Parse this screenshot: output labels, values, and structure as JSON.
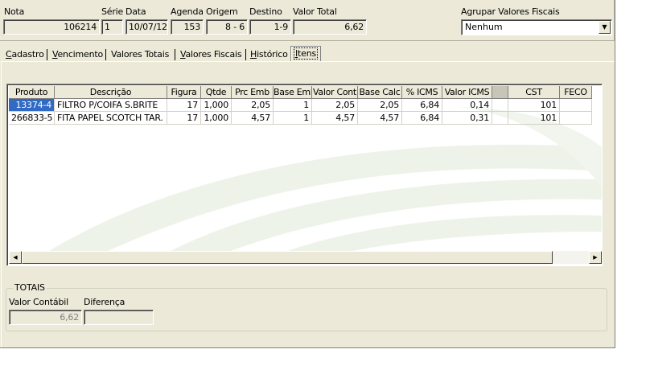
{
  "header": {
    "nota": {
      "label": "Nota",
      "value": "106214"
    },
    "serie": {
      "label": "Série",
      "value": "1"
    },
    "data": {
      "label": "Data",
      "value": "10/07/12"
    },
    "agenda": {
      "label": "Agenda",
      "value": "153"
    },
    "origem": {
      "label": "Origem",
      "value": "8 - 6"
    },
    "destino": {
      "label": "Destino",
      "value": "1-9"
    },
    "valor_total": {
      "label": "Valor Total",
      "value": "6,62"
    },
    "agrupar": {
      "label": "Agrupar Valores Fiscais",
      "value": "Nenhum"
    }
  },
  "tabs": [
    {
      "label": "Cadastro",
      "ul": "C",
      "rest": "adastro"
    },
    {
      "label": "Vencimento",
      "ul": "V",
      "rest": "encimento"
    },
    {
      "label": "Valores Totais",
      "ul": "",
      "rest": "Valores Totais"
    },
    {
      "label": "Valores Fiscais",
      "ul": "V",
      "rest": "alores Fiscais"
    },
    {
      "label": "Histórico",
      "ul": "H",
      "rest": "istórico"
    },
    {
      "label": "Itens",
      "ul": "I",
      "rest": "tens"
    }
  ],
  "grid": {
    "columns": [
      "Produto",
      "Descrição",
      "Figura",
      "Qtde",
      "Prc Emb",
      "Base Emb",
      "Valor Cont",
      "Base Calc",
      "% ICMS",
      "Valor ICMS",
      "",
      "CST",
      "FECO"
    ],
    "rows": [
      [
        "13374-4",
        "FILTRO P/COIFA S.BRITE",
        "17",
        "1,000",
        "2,05",
        "1",
        "2,05",
        "2,05",
        "6,84",
        "0,14",
        "",
        "101",
        ""
      ],
      [
        "266833-5",
        "FITA PAPEL SCOTCH TAR.",
        "17",
        "1,000",
        "4,57",
        "1",
        "4,57",
        "4,57",
        "6,84",
        "0,31",
        "",
        "101",
        ""
      ]
    ]
  },
  "totais": {
    "title": "TOTAIS",
    "valor_contabil": {
      "label": "Valor Contábil",
      "value": "6,62"
    },
    "diferenca": {
      "label": "Diferença",
      "value": ""
    }
  },
  "icons": {
    "combo_arrow": "chevron-down-icon",
    "scroll_left": "arrow-left-icon",
    "scroll_right": "arrow-right-icon"
  }
}
